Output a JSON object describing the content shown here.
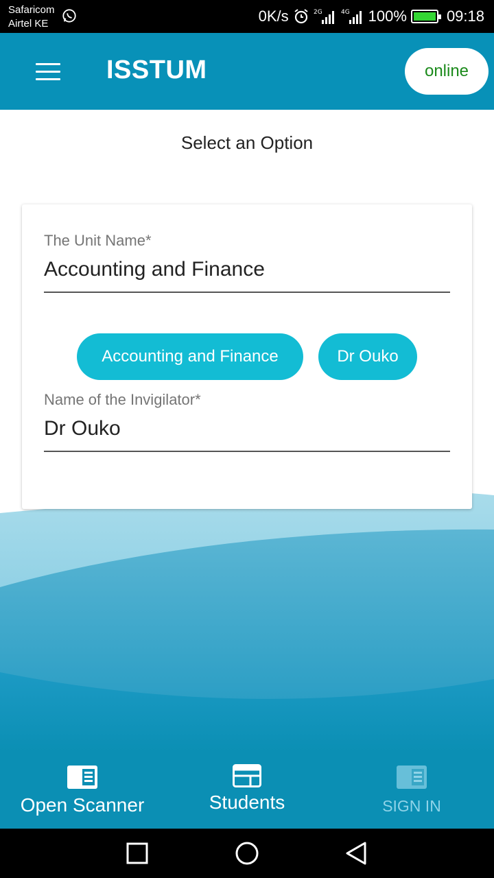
{
  "status_bar": {
    "carrier_1": "Safaricom",
    "carrier_2": "Airtel KE",
    "speed": "0K/s",
    "net_1": "2G",
    "net_2": "4G",
    "battery": "100%",
    "time": "09:18"
  },
  "app_bar": {
    "title": "ISSTUM",
    "status": "online"
  },
  "page": {
    "heading": "Select an Option"
  },
  "form": {
    "unit_label": "The Unit Name*",
    "unit_value": "Accounting and Finance",
    "chips": [
      "Accounting and Finance",
      "Dr Ouko"
    ],
    "invigilator_label": "Name of the Invigilator*",
    "invigilator_value": "Dr Ouko"
  },
  "bottom_nav": {
    "items": [
      {
        "label": "Open Scanner",
        "icon": "scanner-icon"
      },
      {
        "label": "Students",
        "icon": "students-icon"
      },
      {
        "label": "SIGN IN",
        "icon": "sign-in-icon"
      }
    ]
  },
  "colors": {
    "primary": "#0891b8",
    "chip": "#13bcd4",
    "online_text": "#1b8a1b",
    "disabled_nav": "#8fd3e8"
  }
}
